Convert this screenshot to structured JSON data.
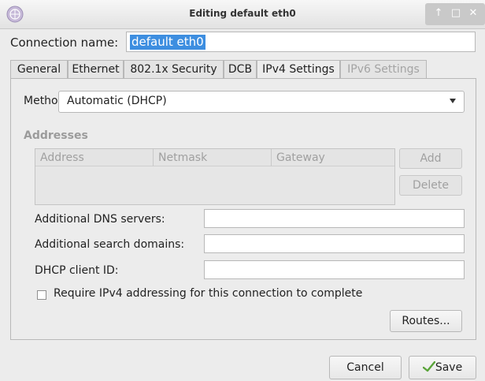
{
  "window": {
    "title": "Editing default eth0"
  },
  "connection": {
    "label": "Connection name:",
    "value": "default eth0"
  },
  "tabs": [
    {
      "label": "General"
    },
    {
      "label": "Ethernet"
    },
    {
      "label": "802.1x Security"
    },
    {
      "label": "DCB"
    },
    {
      "label": "IPv4 Settings"
    },
    {
      "label": "IPv6 Settings"
    }
  ],
  "active_tab": "IPv4 Settings",
  "ipv4": {
    "method_label": "Method:",
    "method_value": "Automatic (DHCP)",
    "addresses_heading": "Addresses",
    "columns": [
      "Address",
      "Netmask",
      "Gateway"
    ],
    "add_label": "Add",
    "delete_label": "Delete",
    "dns_label": "Additional DNS servers:",
    "dns_value": "",
    "search_label": "Additional search domains:",
    "search_value": "",
    "dhcp_label": "DHCP client ID:",
    "dhcp_value": "",
    "require_label": "Require IPv4 addressing for this connection to complete",
    "routes_label": "Routes..."
  },
  "footer": {
    "cancel_label": "Cancel",
    "save_label": "Save"
  },
  "colors": {
    "selection": "#3d8ee0",
    "save_check": "#5aa43a"
  }
}
